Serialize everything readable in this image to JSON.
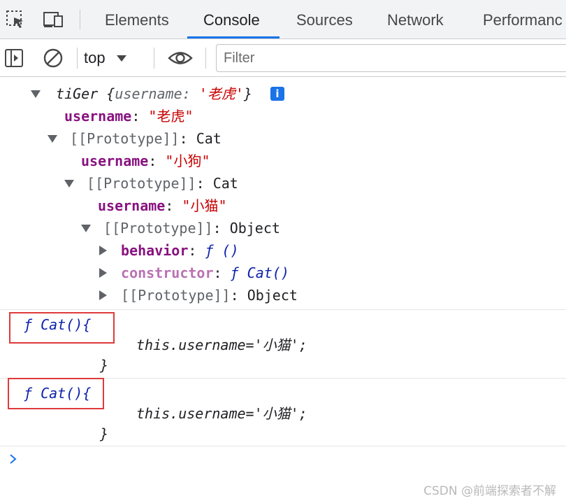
{
  "tabs": {
    "elements": "Elements",
    "console": "Console",
    "sources": "Sources",
    "network": "Network",
    "performance": "Performanc"
  },
  "toolbar": {
    "context": "top",
    "filter_placeholder": "Filter"
  },
  "object_tree": {
    "root_name": "tiGer",
    "root_preview_open": " {",
    "root_preview_key": "username",
    "root_preview_colon": ": ",
    "root_preview_value": "'老虎'",
    "root_preview_close": "}",
    "info_badge": "i",
    "username_key": "username",
    "colon": ": ",
    "root_username": "\"老虎\"",
    "proto_key": "[[Prototype]]",
    "proto1_value": "Cat",
    "proto1_username": "\"小狗\"",
    "proto2_value": "Cat",
    "proto2_username": "\"小猫\"",
    "proto3_value": "Object",
    "behavior_key": "behavior",
    "behavior_value": "ƒ ()",
    "constructor_key": "constructor",
    "constructor_value": "ƒ Cat()",
    "proto4_value": "Object"
  },
  "log_entries": [
    {
      "signature": "ƒ Cat(){",
      "body": "this.username='小猫';",
      "close": "}"
    },
    {
      "signature": "ƒ Cat(){",
      "body": "this.username='小猫';",
      "close": "}"
    }
  ],
  "watermark": "CSDN @前端探索者不解",
  "colors": {
    "accent": "#1a73e8",
    "property_key": "#881280",
    "string_value": "#c80000",
    "function_sig": "#0d22aa",
    "highlight_box": "#e03a3a"
  }
}
